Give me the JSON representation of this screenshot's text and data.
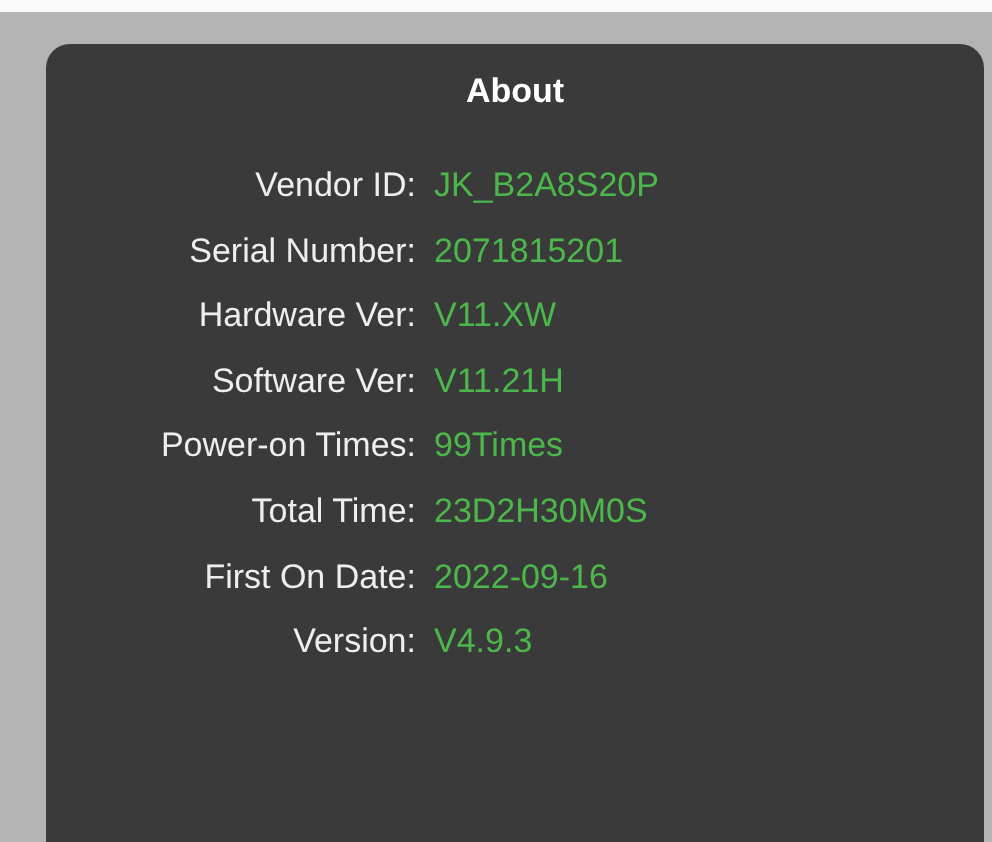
{
  "dialog": {
    "title": "About",
    "fields": [
      {
        "label": "Vendor ID:",
        "value": "JK_B2A8S20P"
      },
      {
        "label": "Serial Number:",
        "value": "2071815201"
      },
      {
        "label": "Hardware Ver:",
        "value": "V11.XW"
      },
      {
        "label": "Software Ver:",
        "value": "V11.21H"
      },
      {
        "label": "Power-on Times:",
        "value": "99Times"
      },
      {
        "label": "Total Time:",
        "value": "23D2H30M0S"
      },
      {
        "label": "First On Date:",
        "value": "2022-09-16"
      },
      {
        "label": "Version:",
        "value": "V4.9.3"
      }
    ]
  }
}
